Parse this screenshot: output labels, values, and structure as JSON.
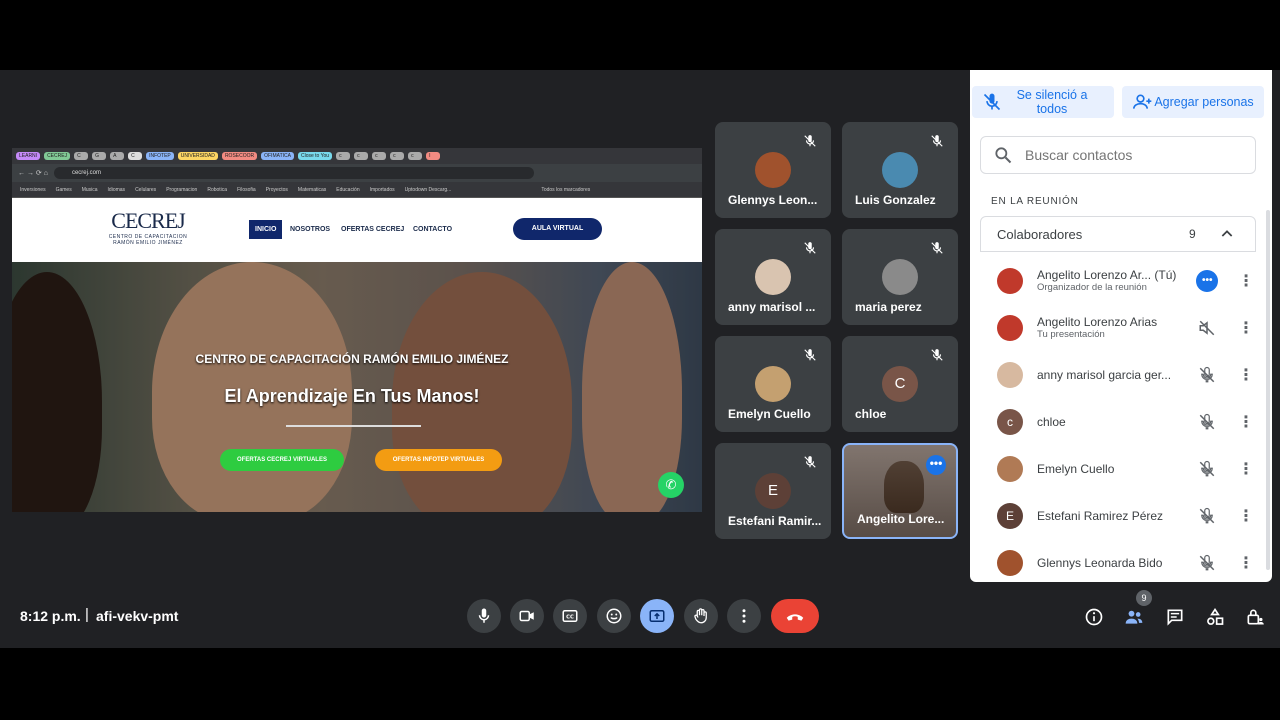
{
  "presentation": {
    "browser_tabs": [
      "LEARNI",
      "CECREJ",
      "C",
      "G",
      "A",
      "C",
      "INFOTEP",
      "UNIVERSIDAD",
      "ROSECOOR",
      "OFIMATICA",
      "Close to You",
      "c",
      "c",
      "c",
      "c",
      "c",
      "I"
    ],
    "address": "cecrej.com",
    "bookmarks": [
      "Inversiones",
      "Games",
      "Musica",
      "Idiomas",
      "Celulares",
      "Programacion",
      "Robotica",
      "Filosofia",
      "Proyectos",
      "Matematicas",
      "Educación",
      "Importados",
      "Uptodown Descarg...",
      "Todos los marcadores"
    ],
    "site": {
      "logo": "CECREJ",
      "logo_sub1": "CENTRO DE CAPACITACION",
      "logo_sub2": "RAMÓN EMILIO JIMÉNEZ",
      "nav": [
        "INICIO",
        "NOSOTROS",
        "OFERTAS CECREJ",
        "CONTACTO"
      ],
      "aula_button": "AULA VIRTUAL",
      "hero_title": "CENTRO DE CAPACITACIÓN RAMÓN EMILIO JIMÉNEZ",
      "hero_subtitle": "El Aprendizaje En Tus Manos!",
      "btn_cecrej": "OFERTAS CECREJ VIRTUALES",
      "btn_infotep": "OFERTAS INFOTEP VIRTUALES"
    }
  },
  "tiles": [
    {
      "name": "Glennys Leon..."
    },
    {
      "name": "Luis Gonzalez"
    },
    {
      "name": "anny marisol ..."
    },
    {
      "name": "maria perez"
    },
    {
      "name": "Emelyn Cuello"
    },
    {
      "name": "chloe",
      "initial": "C"
    },
    {
      "name": "Estefani Ramir...",
      "initial": "E"
    },
    {
      "name": "Angelito Lore..."
    }
  ],
  "panel": {
    "mute_all": "Se silenció a todos",
    "add_people": "Agregar personas",
    "search_placeholder": "Buscar contactos",
    "section": "EN LA REUNIÓN",
    "group_label": "Colaboradores",
    "group_count": "9",
    "people": [
      {
        "name": "Angelito Lorenzo Ar... (Tú)",
        "sub": "Organizador de la reunión"
      },
      {
        "name": "Angelito Lorenzo Arias",
        "sub": "Tu presentación"
      },
      {
        "name": "anny marisol garcia ger...",
        "sub": ""
      },
      {
        "name": "chloe",
        "sub": "",
        "initial": "c"
      },
      {
        "name": "Emelyn Cuello",
        "sub": ""
      },
      {
        "name": "Estefani Ramirez Pérez",
        "sub": "",
        "initial": "E"
      },
      {
        "name": "Glennys Leonarda Bido",
        "sub": ""
      }
    ]
  },
  "bottom": {
    "time": "8:12 p.m.",
    "separator": "|",
    "meeting_code": "afi-vekv-pmt",
    "people_badge": "9"
  },
  "colors": {
    "meet_bg": "#202124",
    "tile_bg": "#3c4043",
    "accent_blue": "#1a73e8",
    "hangup_red": "#ea4335",
    "present_active": "#8ab4f8"
  }
}
